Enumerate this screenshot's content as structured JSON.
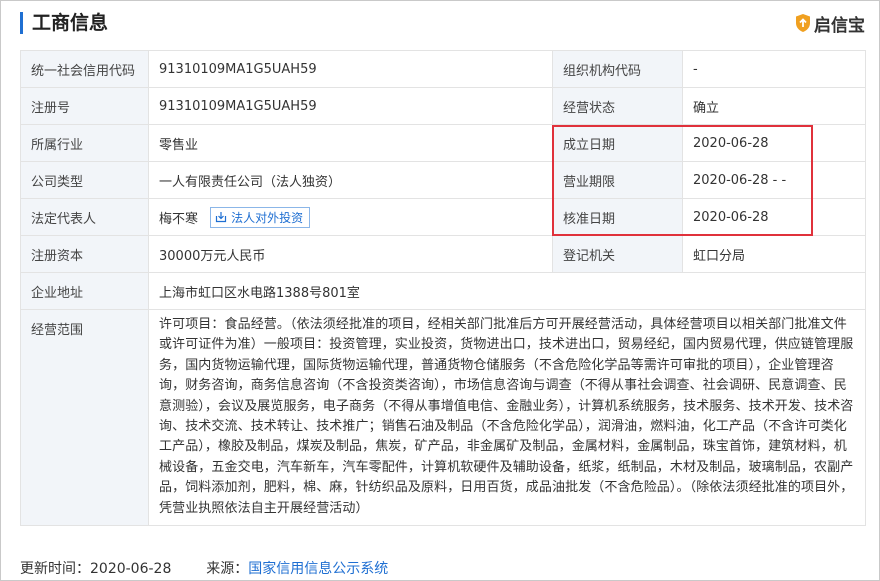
{
  "header": {
    "title": "工商信息",
    "brand": "启信宝"
  },
  "rows": {
    "credit_code_label": "统一社会信用代码",
    "credit_code": "91310109MA1G5UAH59",
    "org_code_label": "组织机构代码",
    "org_code": "-",
    "reg_no_label": "注册号",
    "reg_no": "91310109MA1G5UAH59",
    "status_label": "经营状态",
    "status": "确立",
    "industry_label": "所属行业",
    "industry": "零售业",
    "founded_label": "成立日期",
    "founded": "2020-06-28",
    "type_label": "公司类型",
    "type": "一人有限责任公司（法人独资）",
    "term_label": "营业期限",
    "term": "2020-06-28 - -",
    "legal_rep_label": "法定代表人",
    "legal_rep": "梅不寒",
    "invest_button": "法人对外投资",
    "approve_label": "核准日期",
    "approve": "2020-06-28",
    "capital_label": "注册资本",
    "capital": "30000万元人民币",
    "authority_label": "登记机关",
    "authority": "虹口分局",
    "address_label": "企业地址",
    "address": "上海市虹口区水电路1388号801室",
    "scope_label": "经营范围",
    "scope": "许可项目：食品经营。（依法须经批准的项目，经相关部门批准后方可开展经营活动，具体经营项目以相关部门批准文件或许可证件为准）一般项目：投资管理，实业投资，货物进出口，技术进出口，贸易经纪，国内贸易代理，供应链管理服务，国内货物运输代理，国际货物运输代理，普通货物仓储服务（不含危险化学品等需许可审批的项目），企业管理咨询，财务咨询，商务信息咨询（不含投资类咨询），市场信息咨询与调查（不得从事社会调查、社会调研、民意调查、民意测验），会议及展览服务，电子商务（不得从事增值电信、金融业务），计算机系统服务，技术服务、技术开发、技术咨询、技术交流、技术转让、技术推广；销售石油及制品（不含危险化学品），润滑油，燃料油，化工产品（不含许可类化工产品），橡胶及制品，煤炭及制品，焦炭，矿产品，非金属矿及制品，金属材料，金属制品，珠宝首饰，建筑材料，机械设备，五金交电，汽车新车，汽车零配件，计算机软硬件及辅助设备，纸浆，纸制品，木材及制品，玻璃制品，农副产品，饲料添加剂，肥料，棉、麻，针纺织品及原料，日用百货，成品油批发（不含危险品）。（除依法须经批准的项目外，凭营业执照依法自主开展经营活动）"
  },
  "footer": {
    "updated_label": "更新时间：",
    "updated": "2020-06-28",
    "source_label": "来源：",
    "source": "国家信用信息公示系统"
  },
  "colors": {
    "accent": "#1f6fd2",
    "highlight": "#e0313b",
    "label_bg": "#f2f5f9",
    "logo": "#f0a020"
  }
}
